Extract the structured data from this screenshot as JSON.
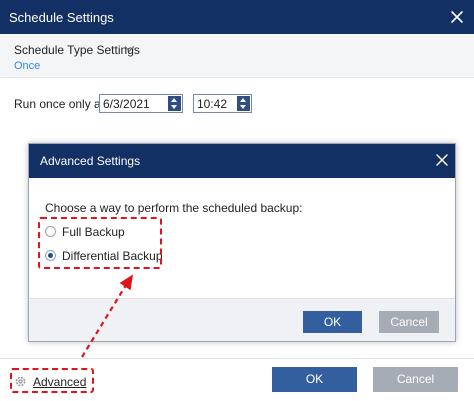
{
  "window": {
    "title": "Schedule Settings",
    "close_icon": "close-icon"
  },
  "schedule_type": {
    "label": "Schedule Type Settings",
    "value": "Once",
    "value_color": "#2d8ae0"
  },
  "run_once": {
    "label": "Run once only at",
    "date": "6/3/2021",
    "time": "10:42"
  },
  "advanced_dialog": {
    "title": "Advanced Settings",
    "prompt": "Choose a way to perform the scheduled backup:",
    "options": [
      {
        "label": "Full Backup",
        "checked": false
      },
      {
        "label": "Differential Backup",
        "checked": true
      }
    ],
    "ok_label": "OK",
    "cancel_label": "Cancel"
  },
  "footer": {
    "advanced_label": "Advanced",
    "ok_label": "OK",
    "cancel_label": "Cancel"
  },
  "colors": {
    "title_bar": "#123063",
    "primary_button": "#345f9e",
    "secondary_button": "#a5acb6",
    "annotation": "#e0141b"
  }
}
